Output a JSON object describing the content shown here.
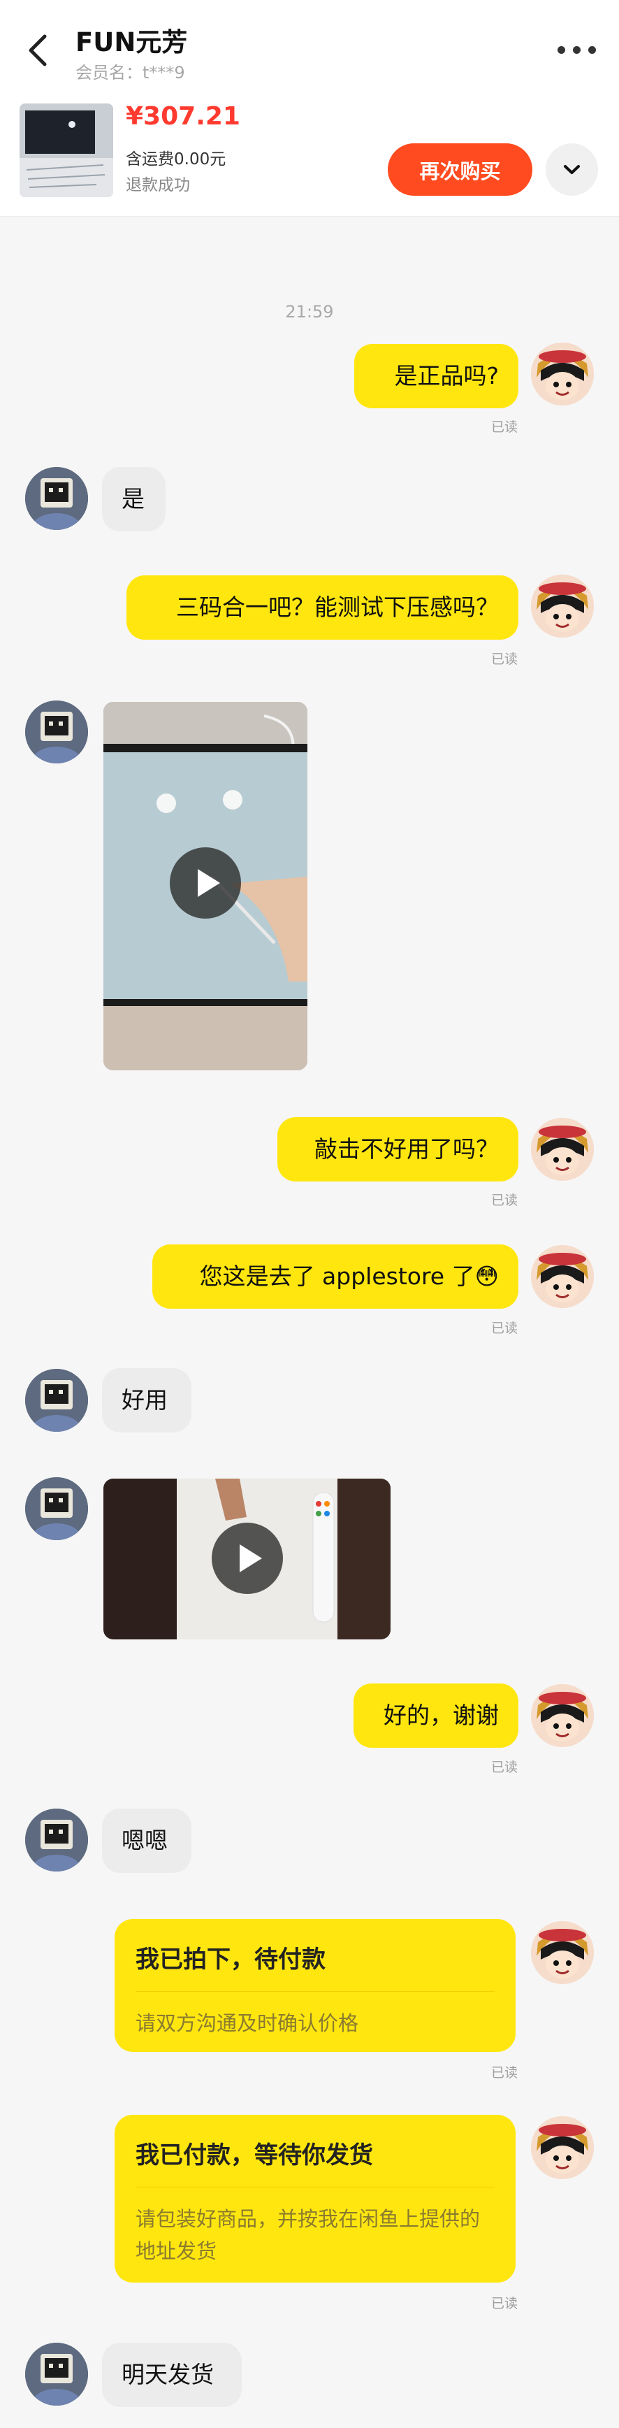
{
  "header": {
    "title": "FUN元芳",
    "member": "会员名：t***9"
  },
  "order": {
    "price": "¥307.21",
    "shipping": "含运费0.00元",
    "status": "退款成功",
    "rebuy_label": "再次购买"
  },
  "chat": {
    "time": "21:59",
    "read_label": "已读",
    "m1": "是正品吗?",
    "m2": "是",
    "m3": "三码合一吧？能测试下压感吗？",
    "m5": "敲击不好用了吗？",
    "m6": "您这是去了 applestore 了😳",
    "m7": "好用",
    "m9": "好的，谢谢",
    "m10": "嗯嗯",
    "card1_title": "我已拍下，待付款",
    "card1_desc": "请双方沟通及时确认价格",
    "card2_title": "我已付款，等待你发货",
    "card2_desc": "请包装好商品，并按我在闲鱼上提供的地址发货",
    "m13": "明天发货"
  },
  "colors": {
    "accent_orange": "#ff4b1f",
    "price_red": "#ff3a2f",
    "bubble_yellow": "#ffe60f"
  }
}
